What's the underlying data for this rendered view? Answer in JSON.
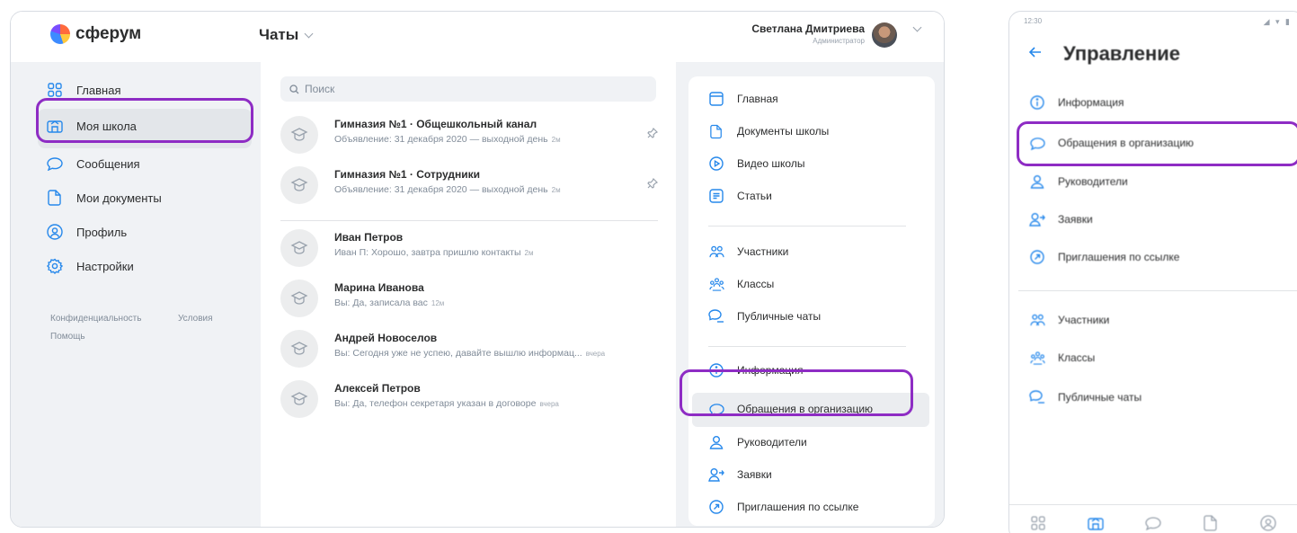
{
  "app": {
    "brand": "сферум",
    "section_title": "Чаты",
    "user": {
      "name": "Светлана Дмитриева",
      "role": "Администратор"
    }
  },
  "sidebar": {
    "items": [
      {
        "label": "Главная",
        "icon": "grid-icon"
      },
      {
        "label": "Моя школа",
        "icon": "school-icon",
        "active": true
      },
      {
        "label": "Сообщения",
        "icon": "message-icon"
      },
      {
        "label": "Мои документы",
        "icon": "document-icon"
      },
      {
        "label": "Профиль",
        "icon": "profile-icon"
      },
      {
        "label": "Настройки",
        "icon": "gear-icon"
      }
    ],
    "links": {
      "privacy": "Конфиденциальность",
      "terms": "Условия",
      "help": "Помощь"
    }
  },
  "chats": {
    "search_placeholder": "Поиск",
    "items": [
      {
        "title": "Гимназия №1 · Общешкольный канал",
        "preview": "Объявление: 31 декабря 2020 — выходной день",
        "time": "2м",
        "pinned": true
      },
      {
        "title": "Гимназия №1 · Сотрудники",
        "preview": "Объявление: 31 декабря 2020 — выходной день",
        "time": "2м",
        "pinned": true
      },
      {
        "title": "Иван Петров",
        "preview": "Иван П: Хорошо, завтра пришлю контакты",
        "time": "2м",
        "pinned": false
      },
      {
        "title": "Марина Иванова",
        "preview": "Вы: Да, записала вас",
        "time": "12м",
        "pinned": false
      },
      {
        "title": "Андрей Новоселов",
        "preview": "Вы: Сегодня уже не успею, давайте вышлю информац...",
        "time": "вчера",
        "pinned": false
      },
      {
        "title": "Алексей Петров",
        "preview": "Вы: Да, телефон секретаря указан в договоре",
        "time": "вчера",
        "pinned": false
      }
    ]
  },
  "school_menu": {
    "items": [
      {
        "label": "Главная",
        "icon": "browser-icon"
      },
      {
        "label": "Документы школы",
        "icon": "document-icon"
      },
      {
        "label": "Видео школы",
        "icon": "play-icon"
      },
      {
        "label": "Статьи",
        "icon": "article-icon"
      },
      {
        "label": "Участники",
        "icon": "users-icon"
      },
      {
        "label": "Классы",
        "icon": "classes-icon"
      },
      {
        "label": "Публичные чаты",
        "icon": "chats-icon"
      },
      {
        "label": "Информация",
        "icon": "info-icon"
      },
      {
        "label": "Обращения в организацию",
        "icon": "message-icon",
        "active": true
      },
      {
        "label": "Руководители",
        "icon": "user-icon"
      },
      {
        "label": "Заявки",
        "icon": "user-add-icon"
      },
      {
        "label": "Приглашения по ссылке",
        "icon": "link-arrow-icon"
      }
    ]
  },
  "phone": {
    "status_time": "12:30",
    "title": "Управление",
    "items": [
      {
        "label": "Информация",
        "icon": "info-icon"
      },
      {
        "label": "Обращения в организацию",
        "icon": "message-icon"
      },
      {
        "label": "Руководители",
        "icon": "user-icon"
      },
      {
        "label": "Заявки",
        "icon": "user-add-icon"
      },
      {
        "label": "Приглашения по ссылке",
        "icon": "link-arrow-icon"
      },
      {
        "label": "Участники",
        "icon": "users-icon"
      },
      {
        "label": "Классы",
        "icon": "classes-icon"
      },
      {
        "label": "Публичные чаты",
        "icon": "chats-icon"
      }
    ],
    "tabs": [
      "grid-icon",
      "school-icon",
      "message-icon",
      "document-icon",
      "profile-icon"
    ]
  },
  "colors": {
    "highlight": "#8e2cc4",
    "accent": "#2688eb",
    "panel_bg": "#f0f2f5"
  }
}
